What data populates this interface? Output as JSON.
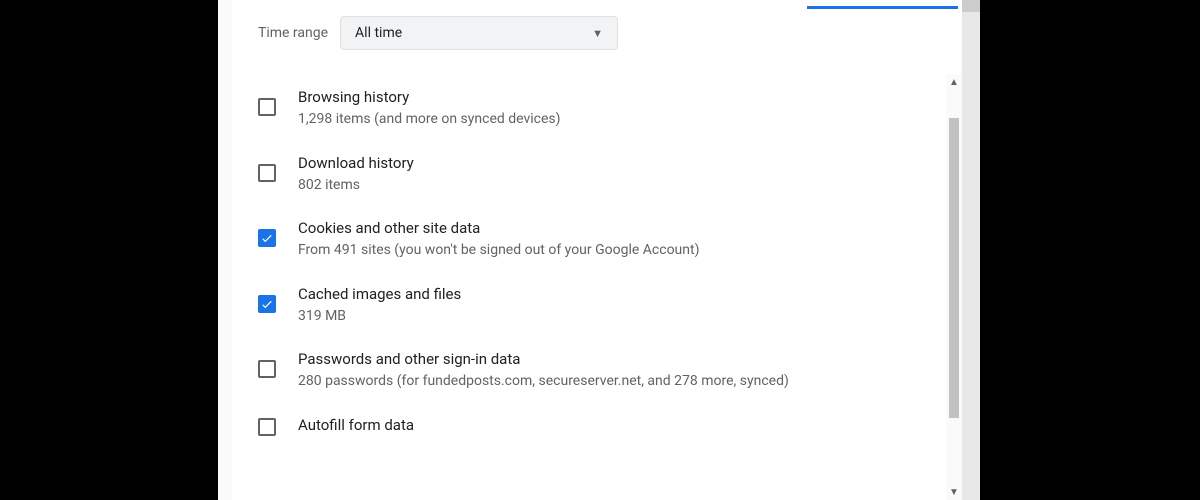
{
  "timeRange": {
    "label": "Time range",
    "selected": "All time"
  },
  "options": [
    {
      "title": "Browsing history",
      "subtitle": "1,298 items (and more on synced devices)",
      "checked": false
    },
    {
      "title": "Download history",
      "subtitle": "802 items",
      "checked": false
    },
    {
      "title": "Cookies and other site data",
      "subtitle": "From 491 sites (you won't be signed out of your Google Account)",
      "checked": true
    },
    {
      "title": "Cached images and files",
      "subtitle": "319 MB",
      "checked": true
    },
    {
      "title": "Passwords and other sign-in data",
      "subtitle": "280 passwords (for fundedposts.com, secureserver.net, and 278 more, synced)",
      "checked": false
    },
    {
      "title": "Autofill form data",
      "subtitle": "",
      "checked": false
    }
  ]
}
